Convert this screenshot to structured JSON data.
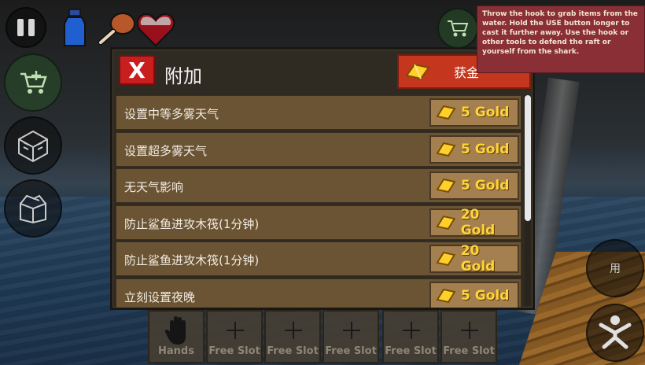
{
  "panel": {
    "close_label": "X",
    "title": "附加",
    "gold_button_label": "获金"
  },
  "items": [
    {
      "label": "设置中等多雾天气",
      "price": "5 Gold"
    },
    {
      "label": "设置超多雾天气",
      "price": "5 Gold"
    },
    {
      "label": "无天气影响",
      "price": "5 Gold"
    },
    {
      "label": "防止鲨鱼进攻木筏(1分钟)",
      "price": "20 Gold"
    },
    {
      "label": "防止鲨鱼进攻木筏(1分钟)",
      "price": "20 Gold"
    },
    {
      "label": "立刻设置夜晚",
      "price": "5 Gold"
    }
  ],
  "tooltip": {
    "text": "Throw the hook to grab items from the water. Hold the USE button longer to cast it further away. Use the hook or other tools to defend the raft or yourself from the shark."
  },
  "hud": {
    "use_label": "用",
    "status_icons": [
      "water-bottle-icon",
      "food-drumstick-icon",
      "health-heart-icon"
    ]
  },
  "hotbar": {
    "slots": [
      "Hands",
      "Free Slot",
      "Free Slot",
      "Free Slot",
      "Free Slot",
      "Free Slot"
    ]
  },
  "colors": {
    "close_red": "#c81e1e",
    "gold_text": "#ffd43a",
    "row_brown": "#6b5434",
    "tooltip_bg": "#8a2f36"
  }
}
